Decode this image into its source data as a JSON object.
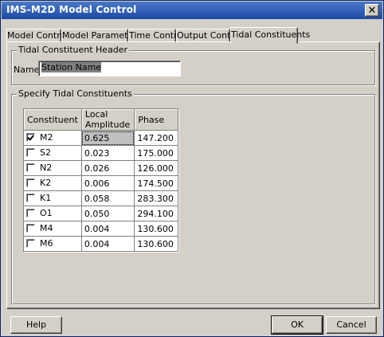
{
  "window": {
    "title": "IMS-M2D Model Control"
  },
  "tabs": [
    {
      "label": "Model Control"
    },
    {
      "label": "Model Parameters"
    },
    {
      "label": "Time Control"
    },
    {
      "label": "Output Control"
    },
    {
      "label": "Tidal Constituents",
      "active": true
    }
  ],
  "header_group": {
    "label": "Tidal Constituent Header",
    "name_label": "Name:",
    "name_value": "Station Name"
  },
  "constituents_group": {
    "label": "Specify Tidal Constituents",
    "columns": [
      "Constituent",
      "Local Amplitude",
      "Phase"
    ],
    "rows": [
      {
        "checked": true,
        "name": "M2",
        "amplitude": "0.625",
        "phase": "147.200"
      },
      {
        "checked": false,
        "name": "S2",
        "amplitude": "0.023",
        "phase": "175.000"
      },
      {
        "checked": false,
        "name": "N2",
        "amplitude": "0.026",
        "phase": "126.000"
      },
      {
        "checked": false,
        "name": "K2",
        "amplitude": "0.006",
        "phase": "174.500"
      },
      {
        "checked": false,
        "name": "K1",
        "amplitude": "0.058",
        "phase": "283.300"
      },
      {
        "checked": false,
        "name": "O1",
        "amplitude": "0.050",
        "phase": "294.100"
      },
      {
        "checked": false,
        "name": "M4",
        "amplitude": "0.004",
        "phase": "130.600"
      },
      {
        "checked": false,
        "name": "M6",
        "amplitude": "0.004",
        "phase": "130.600"
      }
    ]
  },
  "buttons": {
    "help": "Help",
    "ok": "OK",
    "cancel": "Cancel"
  },
  "icons": {
    "close": "close-icon",
    "check": "check-icon"
  }
}
